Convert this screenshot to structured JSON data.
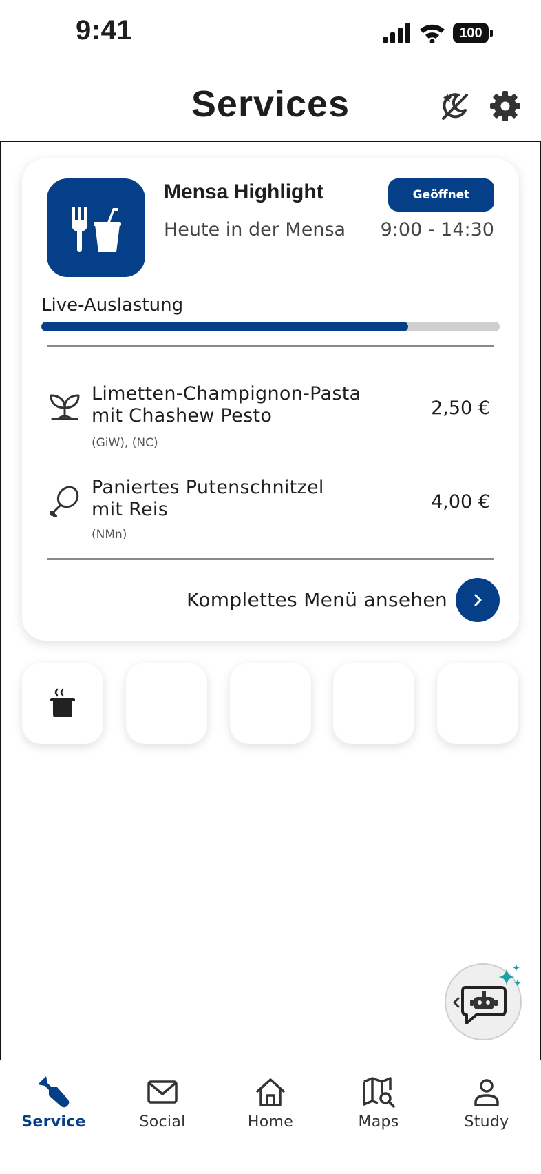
{
  "status_bar": {
    "time": "9:41",
    "battery": "100"
  },
  "header": {
    "title": "Services",
    "icons": [
      "dark-mode-icon",
      "gear-icon"
    ]
  },
  "mensa_card": {
    "title": "Mensa Highlight",
    "subtitle": "Heute in der Mensa",
    "status": "Geöffnet",
    "hours": "9:00 - 14:30",
    "live_label": "Live-Auslastung",
    "live_load": 0.8,
    "dishes": [
      {
        "name_line1": "Limetten-Champignon-Pasta",
        "name_line2": "mit Chashew Pesto",
        "tags": "(GiW), (NC)",
        "price": "2,50 €",
        "icon": "vegetarian-sprout-icon"
      },
      {
        "name_line1": "Paniertes Putenschnitzel",
        "name_line2": "mit Reis",
        "tags": "(NMn)",
        "price": "4,00 €",
        "icon": "poultry-drumstick-icon"
      }
    ],
    "full_menu_label": "Komplettes Menü ansehen"
  },
  "quick_tiles": [
    "cooking-pot-icon",
    "",
    "",
    "",
    ""
  ],
  "nav": {
    "items": [
      {
        "label": "Service",
        "icon": "wrench-icon",
        "active": true
      },
      {
        "label": "Social",
        "icon": "mail-icon",
        "active": false
      },
      {
        "label": "Home",
        "icon": "home-icon",
        "active": false
      },
      {
        "label": "Maps",
        "icon": "map-search-icon",
        "active": false
      },
      {
        "label": "Study",
        "icon": "person-icon",
        "active": false
      }
    ]
  },
  "colors": {
    "primary": "#053f88",
    "accent": "#1aa3a8"
  }
}
